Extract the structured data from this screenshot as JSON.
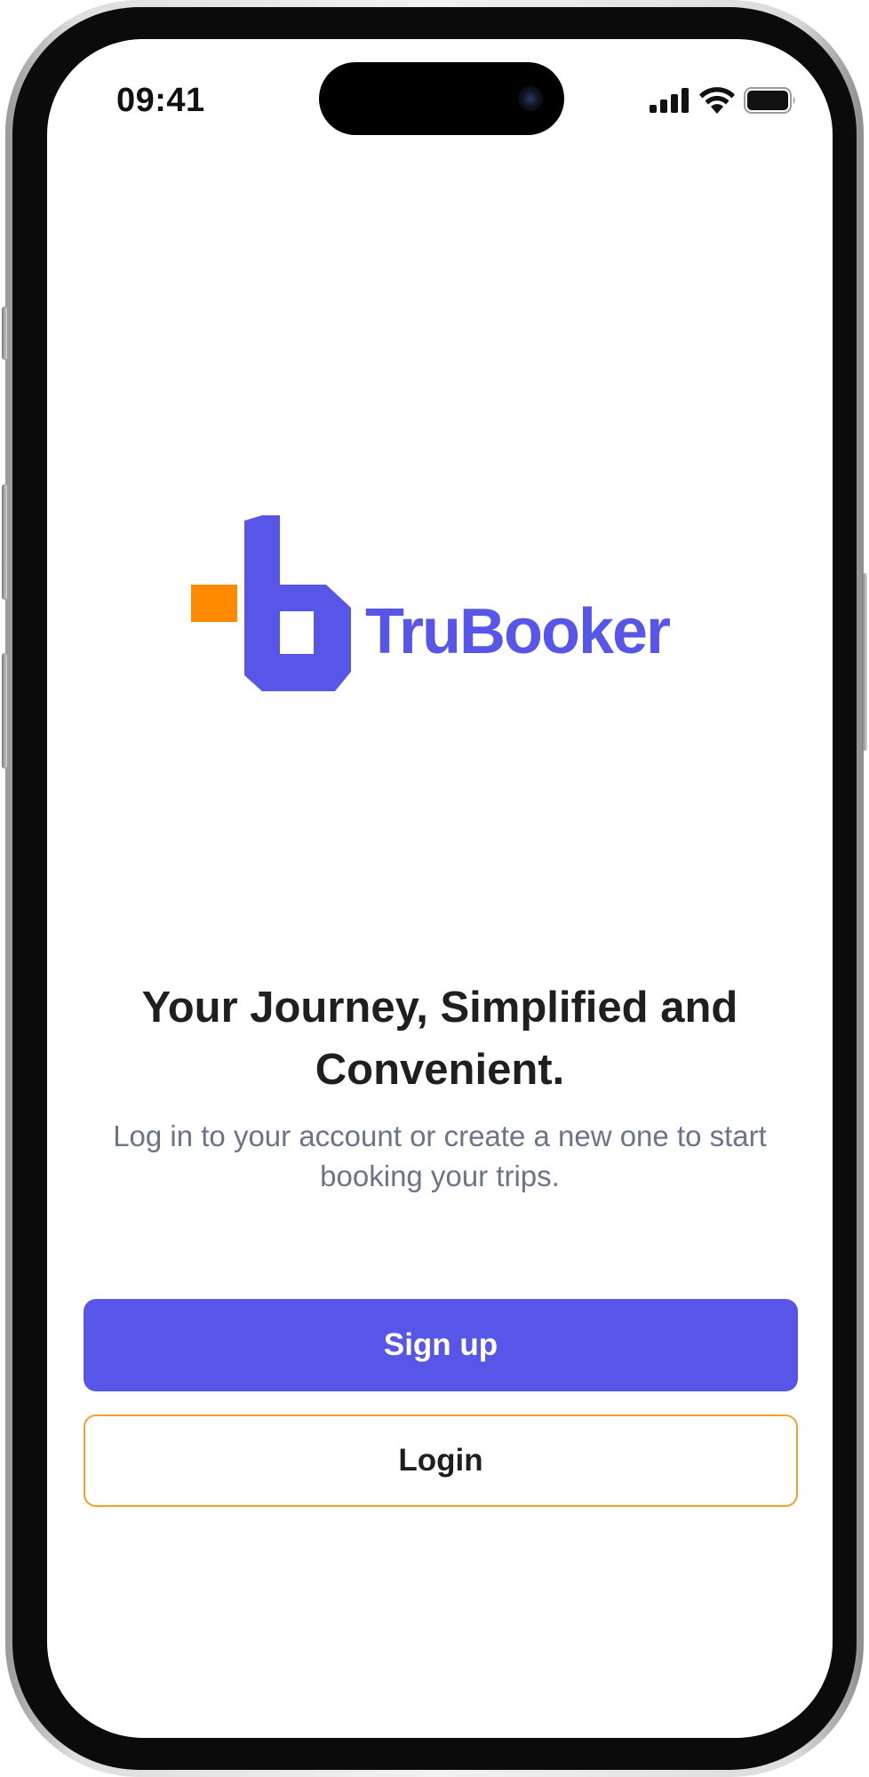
{
  "status_bar": {
    "time": "09:41",
    "icons": [
      "cellular-signal-icon",
      "wifi-icon",
      "battery-icon"
    ]
  },
  "brand": {
    "name": "TruBooker",
    "primary_color": "#5856e8",
    "accent_color": "#ff8a00"
  },
  "onboarding": {
    "headline": "Your Journey, Simplified and Convenient.",
    "subtext": "Log in to your account or create a new one to start booking your trips."
  },
  "actions": {
    "signup_label": "Sign up",
    "login_label": "Login",
    "login_border_color": "#f5a028"
  }
}
